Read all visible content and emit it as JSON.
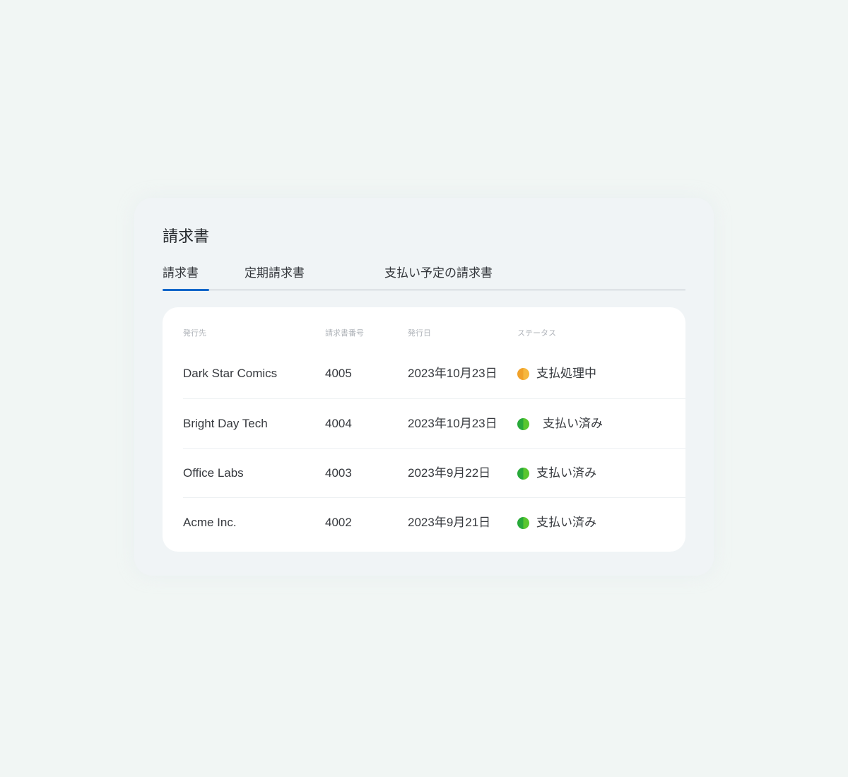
{
  "page": {
    "title": "請求書"
  },
  "tabs": [
    {
      "label": "請求書",
      "active": true
    },
    {
      "label": "定期請求書",
      "active": false
    },
    {
      "label": "支払い予定の請求書",
      "active": false
    }
  ],
  "table": {
    "columns": [
      "発行先",
      "請求書番号",
      "発行日",
      "ステータス"
    ],
    "rows": [
      {
        "recipient": "Dark Star Comics",
        "number": "4005",
        "date": "2023年10月23日",
        "status": "支払処理中",
        "status_color": "#f0a12a"
      },
      {
        "recipient": "Bright Day Tech",
        "number": "4004",
        "date": "2023年10月23日",
        "status": "支払い済み",
        "status_color": "#3bb535"
      },
      {
        "recipient": "Office Labs",
        "number": "4003",
        "date": "2023年9月22日",
        "status": "支払い済み",
        "status_color": "#3bb535"
      },
      {
        "recipient": "Acme Inc.",
        "number": "4002",
        "date": "2023年9月21日",
        "status": "支払い済み",
        "status_color": "#3bb535"
      }
    ]
  },
  "colors": {
    "background": "#f1f6f4",
    "accent": "#1266c9",
    "pending": "#f0a12a",
    "paid": "#3bb535"
  }
}
